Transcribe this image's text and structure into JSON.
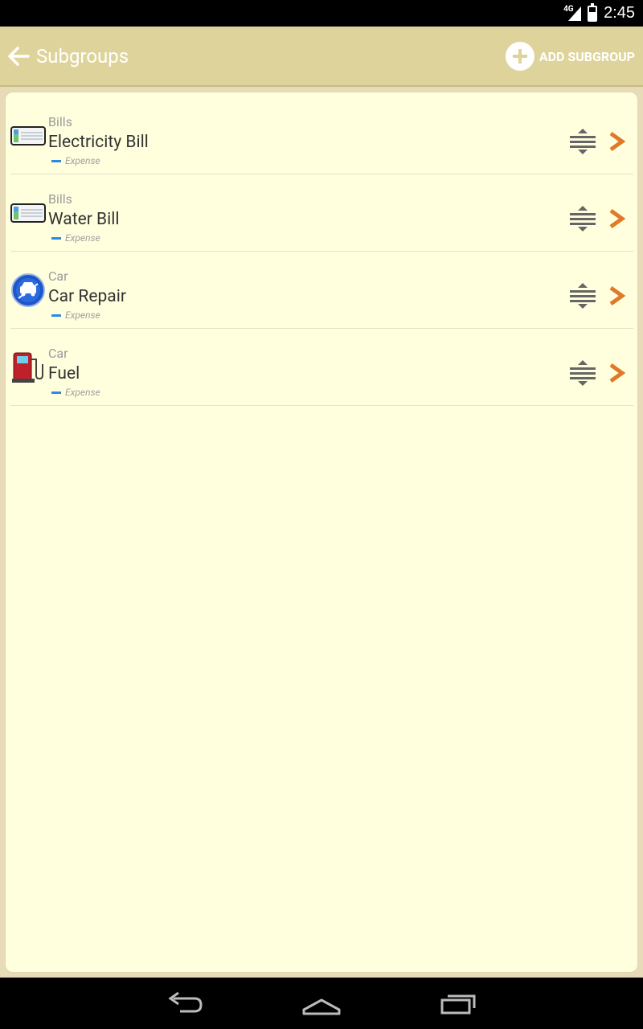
{
  "status": {
    "network": "4G",
    "time": "2:45"
  },
  "actionbar": {
    "title": "Subgroups",
    "add_label": "ADD SUBGROUP"
  },
  "items": [
    {
      "group": "Bills",
      "name": "Electricity Bill",
      "type": "Expense",
      "icon": "bill-icon"
    },
    {
      "group": "Bills",
      "name": "Water Bill",
      "type": "Expense",
      "icon": "bill-icon"
    },
    {
      "group": "Car",
      "name": "Car Repair",
      "type": "Expense",
      "icon": "car-repair-icon"
    },
    {
      "group": "Car",
      "name": "Fuel",
      "type": "Expense",
      "icon": "fuel-pump-icon"
    }
  ],
  "colors": {
    "actionbar": "#ded49b",
    "panel": "#ffffde",
    "chevron": "#e07a2a",
    "expense_marker": "#2a8be0"
  }
}
